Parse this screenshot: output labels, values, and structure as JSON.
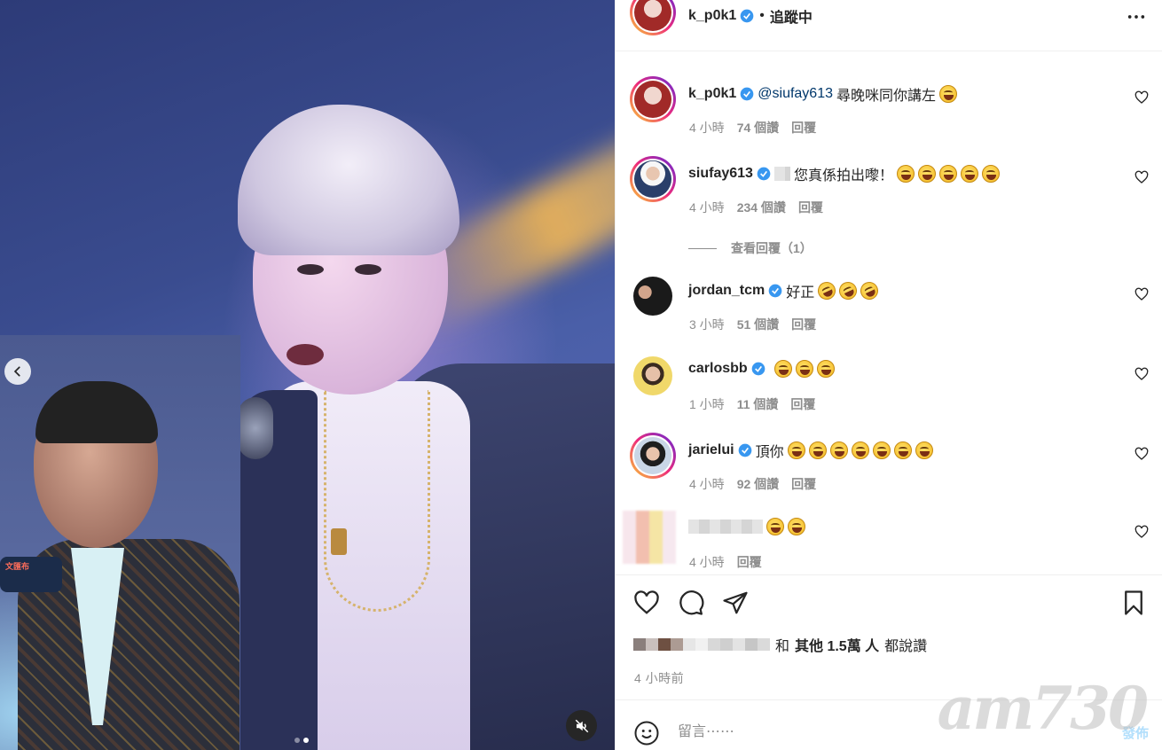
{
  "header": {
    "username": "k_p0k1",
    "separator": "•",
    "follow_status": "追蹤中"
  },
  "comments": [
    {
      "username": "k_p0k1",
      "verified": true,
      "mention": "@siufay613",
      "text": " 尋晚咪同你講左",
      "emojis": [
        "grinning-sweat-emoji"
      ],
      "time": "4 小時",
      "likes": "74 個讚",
      "reply": "回覆"
    },
    {
      "username": "siufay613",
      "verified": true,
      "text": "您真係拍出嚟！",
      "emojis": [
        "tears-of-joy-emoji",
        "tears-of-joy-emoji",
        "tears-of-joy-emoji",
        "tears-of-joy-emoji",
        "tears-of-joy-emoji"
      ],
      "time": "4 小時",
      "likes": "234 個讚",
      "reply": "回覆"
    },
    {
      "username": "jordan_tcm",
      "verified": true,
      "text": "好正",
      "emojis": [
        "rofl-emoji",
        "rofl-emoji",
        "rofl-emoji"
      ],
      "time": "3 小時",
      "likes": "51 個讚",
      "reply": "回覆"
    },
    {
      "username": "carlosbb",
      "verified": true,
      "text": "",
      "emojis": [
        "tears-of-joy-emoji",
        "tears-of-joy-emoji",
        "tears-of-joy-emoji"
      ],
      "time": "1 小時",
      "likes": "11 個讚",
      "reply": "回覆"
    },
    {
      "username": "jarielui",
      "verified": true,
      "text": "頂你",
      "emojis": [
        "tears-of-joy-emoji",
        "tears-of-joy-emoji",
        "tears-of-joy-emoji",
        "tears-of-joy-emoji",
        "tears-of-joy-emoji",
        "tears-of-joy-emoji",
        "tears-of-joy-emoji"
      ],
      "time": "4 小時",
      "likes": "92 個讚",
      "reply": "回覆"
    },
    {
      "username": "",
      "verified": false,
      "text": "",
      "emojis": [
        "tears-of-joy-emoji",
        "tears-of-joy-emoji"
      ],
      "time": "4 小時",
      "likes": "",
      "reply": "回覆"
    }
  ],
  "view_replies": "查看回覆（1）",
  "likes": {
    "conjunction": "和",
    "others": "其他 1.5萬 人",
    "suffix": "都說讚"
  },
  "time_ago": "4 小時前",
  "comment_box": {
    "placeholder": "留言⋯⋯",
    "post_label": "發佈"
  },
  "media": {
    "inset_mic_text": "文匯布",
    "carousel_count": 2,
    "carousel_active": 2
  },
  "watermark": "am730",
  "colors": {
    "verified_blue": "#3897f0",
    "mention": "#00376b",
    "muted_text": "#8e8e8e",
    "post_button": "#b2dffc"
  }
}
